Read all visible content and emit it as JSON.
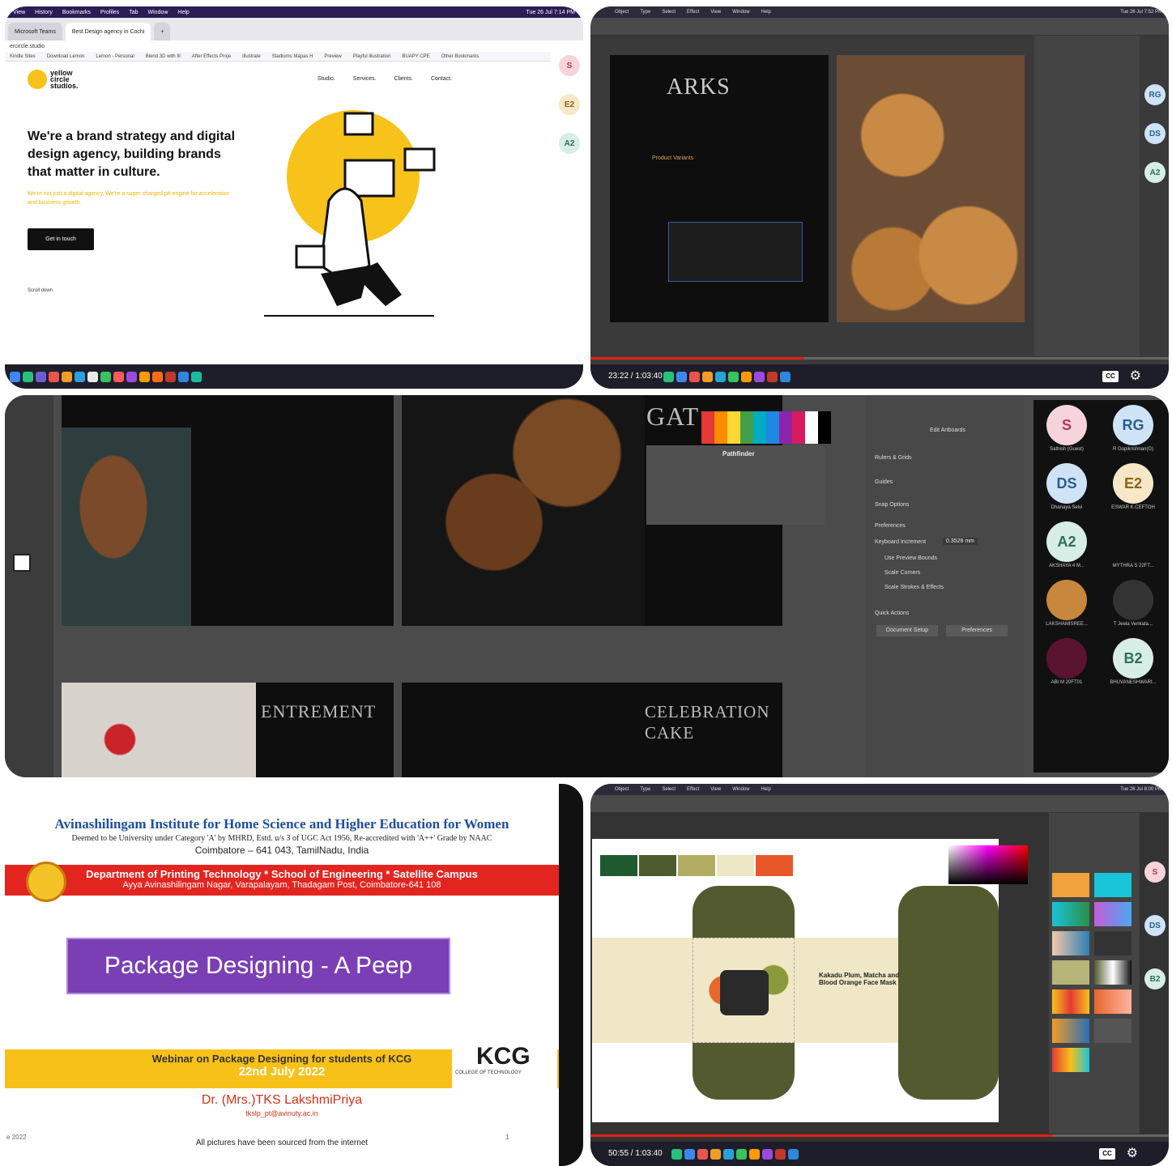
{
  "p1": {
    "macmenu": [
      "View",
      "History",
      "Bookmarks",
      "Profiles",
      "Tab",
      "Window",
      "Help"
    ],
    "clock": "Tue 26 Jul 7:14 PM",
    "tabs": [
      "Microsoft Teams",
      "Best Design agency in Cochi"
    ],
    "address": "ercircle.studio",
    "bookmarks": [
      "Kindle Sites",
      "Download Lemon",
      "Lemon - Personal",
      "Blend 3D with Ill",
      "After Effects Proje",
      "Illustrate",
      "Stadiums Mapas H",
      "Preview",
      "Playful illustration",
      "BUAPY CPE",
      "Other Bookmarks"
    ],
    "logo": "yellow circle studios.",
    "nav": [
      "Studio.",
      "Services.",
      "Clients.",
      "Contact."
    ],
    "hero": "We're a brand strategy and digital design agency, building brands that matter in culture.",
    "hero_sub": "We're not just a digital agency, We're a super charged pit-engine for acceleration and business growth.",
    "cta": "Get in touch",
    "scroll": "Scroll down",
    "avatars": [
      "S",
      "E2",
      "A2"
    ]
  },
  "p2": {
    "menu": [
      "Object",
      "Type",
      "Select",
      "Effect",
      "View",
      "Window",
      "Help"
    ],
    "clock": "Tue 26 Jul 7:52 PM",
    "title": "ARKS",
    "product_variants": "Product Variants",
    "timecode": "23:22 / 1:03:40",
    "avatars": [
      "RG",
      "DS",
      "A2"
    ]
  },
  "p3": {
    "title_cat": "GAT",
    "entremet": "ENTREMENT",
    "celebration": "CELEBRATION CAKE",
    "panel_labels": [
      "Edit Artboards",
      "Rulers & Grids",
      "Guides",
      "Snap Options",
      "Preferences",
      "Keyboard Increment",
      "Use Preview Bounds",
      "Scale Corners",
      "Scale Strokes & Effects",
      "Quick Actions",
      "Document Setup",
      "Preferences"
    ],
    "keyboard_increment": "0.3528 mm",
    "pathfinder": "Pathfinder",
    "avatars": [
      {
        "initials": "S",
        "name": "Sathish (Guest)",
        "bg": "#f7d3dc",
        "fg": "#b0375a"
      },
      {
        "initials": "RG",
        "name": "R Gopikrishnan(G)",
        "bg": "#cfe3f7",
        "fg": "#2c5e8f"
      },
      {
        "initials": "DS",
        "name": "Dhanaya Selvi",
        "bg": "#cfe3f7",
        "fg": "#2c5e8f"
      },
      {
        "initials": "E2",
        "name": "ESWAR K CEFTOH",
        "bg": "#f6e7c6",
        "fg": "#8a6417"
      },
      {
        "initials": "A2",
        "name": "AKSHAYA 4 M...",
        "bg": "#d7eee6",
        "fg": "#2f6e5a"
      },
      {
        "initials": "",
        "name": "MYTHRA S 22FT...",
        "bg": "#3a3a3a",
        "fg": "#ccc"
      },
      {
        "initials": "",
        "name": "LAKSHAMISREE...",
        "bg": "#c8873d",
        "fg": "#fff"
      },
      {
        "initials": "",
        "name": "T Jeela Venkata...",
        "bg": "#555",
        "fg": "#ccc"
      },
      {
        "initials": "",
        "name": "ABI M 20FT01",
        "bg": "#5a1430",
        "fg": "#fff"
      },
      {
        "initials": "B2",
        "name": "BHUVANESHWARI...",
        "bg": "#d7eee6",
        "fg": "#2f6e5a"
      }
    ]
  },
  "p4": {
    "institution": "Avinashilingam Institute for Home Science and Higher Education for Women",
    "deemed": "Deemed to be University under Category 'A' by MHRD, Estd. u/s 3 of UGC Act 1956, Re-accredited with 'A++' Grade by NAAC",
    "city": "Coimbatore – 641 043, TamilNadu, India",
    "department": "Department of Printing Technology * School of Engineering * Satellite Campus",
    "address": "Ayya Avinashilingam Nagar, Varapalayam, Thadagam Post, Coimbatore-641 108",
    "title": "Package Designing - A Peep",
    "webinar": "Webinar on Package Designing for students of KCG",
    "date": "22nd July 2022",
    "kcg": "KCG",
    "kcg_sub": "COLLEGE OF TECHNOLOGY",
    "presenter": "Dr. (Mrs.)TKS LakshmiPriya",
    "email": "tkslp_pt@avinuty.ac.in",
    "credits": "All pictures have been sourced from the internet",
    "footer_left": "e 2022",
    "page": "1"
  },
  "p5": {
    "menu": [
      "Object",
      "Type",
      "Select",
      "Effect",
      "View",
      "Window",
      "Help"
    ],
    "clock": "Tue 26 Jul 8:00 PM",
    "product": "Kakadu Plum, Matcha and Blood Orange Face Mask",
    "timecode": "50:55 / 1:03:40",
    "swatches": [
      "#1f5a2e",
      "#4d5a2e",
      "#b3ad63",
      "#ece6c4",
      "#e8572a"
    ],
    "avatars": [
      "S",
      "DS",
      "B2"
    ]
  }
}
